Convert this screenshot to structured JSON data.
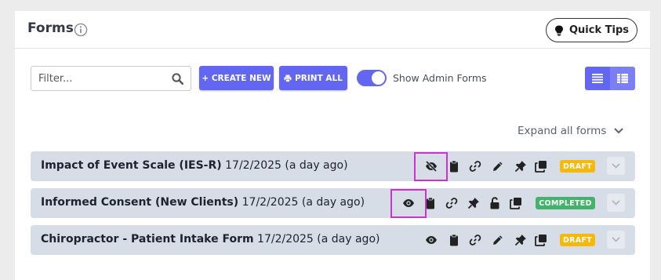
{
  "header": {
    "title": "Forms",
    "quick_tips_label": "Quick Tips"
  },
  "toolbar": {
    "filter_placeholder": "Filter...",
    "filter_value": "",
    "create_label": "+ CREATE NEW",
    "print_label": "PRINT ALL",
    "toggle_label": "Show Admin Forms",
    "toggle_on": true,
    "view_modes": [
      "list-view-icon",
      "table-view-icon"
    ]
  },
  "expand_all_label": "Expand all forms",
  "forms": [
    {
      "name": "Impact of Event Scale (IES-R)",
      "date": "17/2/2025 (a day ago)",
      "status": "DRAFT",
      "actions": [
        "eye-slash-icon",
        "clipboard-icon",
        "link-icon",
        "pencil-icon",
        "pin-icon",
        "copy-icon"
      ],
      "highlighted_action": "eye-slash-icon"
    },
    {
      "name": "Informed Consent (New Clients)",
      "date": "17/2/2025 (a day ago)",
      "status": "COMPLETED",
      "actions": [
        "eye-icon",
        "clipboard-icon",
        "link-icon",
        "pin-icon",
        "unlock-icon",
        "copy-icon"
      ],
      "highlighted_action": "eye-icon"
    },
    {
      "name": "Chiropractor - Patient Intake Form",
      "date": "17/2/2025 (a day ago)",
      "status": "DRAFT",
      "actions": [
        "eye-icon",
        "clipboard-icon",
        "link-icon",
        "pencil-icon",
        "pin-icon",
        "copy-icon"
      ]
    }
  ],
  "colors": {
    "accent": "#6366f1",
    "row_bg": "#d6dde7",
    "draft": "#f5b90b",
    "completed": "#43b36b",
    "highlight": "#cc33cc"
  }
}
